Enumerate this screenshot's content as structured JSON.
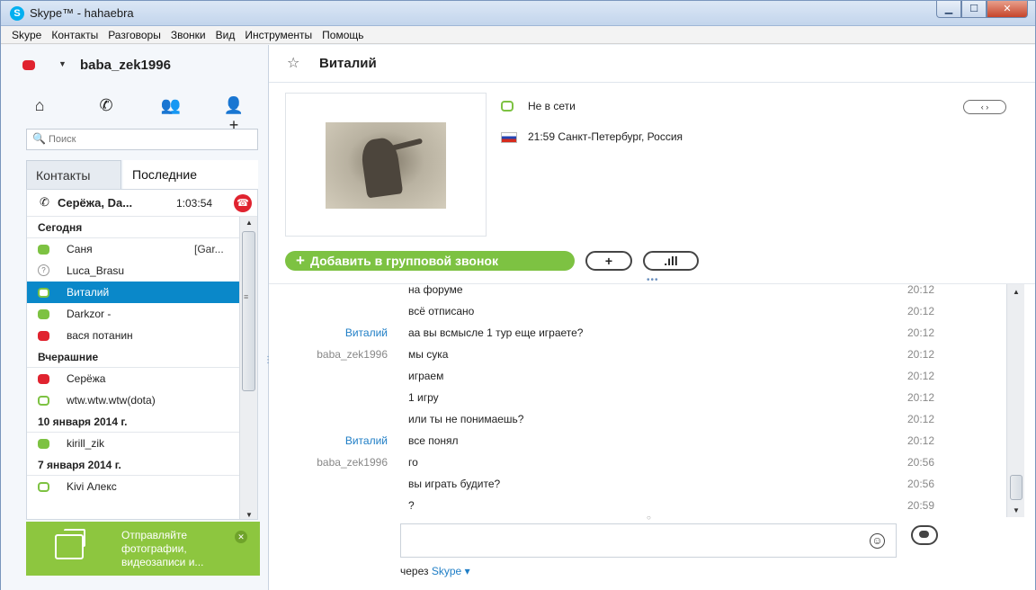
{
  "window": {
    "title": "Skype™ - hahaebra",
    "app_icon": "S"
  },
  "menu": [
    "Skype",
    "Контакты",
    "Разговоры",
    "Звонки",
    "Вид",
    "Инструменты",
    "Помощь"
  ],
  "me": {
    "name": "baba_zek1996",
    "status_color": "#e0232f"
  },
  "search": {
    "placeholder": "Поиск"
  },
  "tabs": {
    "contacts": "Контакты",
    "recent": "Последние"
  },
  "active_call": {
    "name": "Серёжа, Da...",
    "duration": "1:03:54"
  },
  "groups": [
    {
      "header": "Сегодня",
      "contacts": [
        {
          "name": "Саня",
          "status": "online",
          "extra": "[Gar..."
        },
        {
          "name": "Luca_Brasu",
          "status": "unknown",
          "extra": ""
        },
        {
          "name": "Виталий",
          "status": "offline",
          "extra": "",
          "selected": true
        },
        {
          "name": "Darkzor -",
          "status": "online",
          "extra": ""
        },
        {
          "name": "вася потанин",
          "status": "busy",
          "extra": ""
        }
      ]
    },
    {
      "header": "Вчерашние",
      "contacts": [
        {
          "name": "Серёжа",
          "status": "busy",
          "extra": ""
        },
        {
          "name": "wtw.wtw.wtw(dota)",
          "status": "offline",
          "extra": ""
        }
      ]
    },
    {
      "header": "10 января 2014 г.",
      "contacts": [
        {
          "name": "kirill_zik",
          "status": "online",
          "extra": ""
        }
      ]
    },
    {
      "header": "7 января 2014 г.",
      "contacts": [
        {
          "name": "Kivi Алекс",
          "status": "offline",
          "extra": ""
        }
      ]
    }
  ],
  "promo": {
    "text": "Отправляйте фотографии, видеозаписи и..."
  },
  "conversation": {
    "contact_name": "Виталий",
    "status_text": "Не в сети",
    "location": "21:59 Санкт-Петербург, Россия",
    "add_group_call": "Добавить в групповой звонок",
    "pager": "‹ ›"
  },
  "messages": [
    {
      "who": "",
      "side": "them",
      "text": "на форуме",
      "time": "20:12"
    },
    {
      "who": "",
      "side": "them",
      "text": "всё отписано",
      "time": "20:12"
    },
    {
      "who": "Виталий",
      "side": "them",
      "text": "аа вы всмысле 1 тур еще играете?",
      "time": "20:12"
    },
    {
      "who": "baba_zek1996",
      "side": "me",
      "text": "мы сука",
      "time": "20:12"
    },
    {
      "who": "",
      "side": "me",
      "text": "играем",
      "time": "20:12"
    },
    {
      "who": "",
      "side": "me",
      "text": "1 игру",
      "time": "20:12"
    },
    {
      "who": "",
      "side": "me",
      "text": "или ты не понимаешь?",
      "time": "20:12"
    },
    {
      "who": "Виталий",
      "side": "them",
      "text": "все понял",
      "time": "20:12"
    },
    {
      "who": "baba_zek1996",
      "side": "me",
      "text": "го",
      "time": "20:56"
    },
    {
      "who": "",
      "side": "me",
      "text": "вы играть будите?",
      "time": "20:56"
    },
    {
      "who": "",
      "side": "me",
      "text": "?",
      "time": "20:59"
    }
  ],
  "footer": {
    "via": "через",
    "via_link": "Skype"
  },
  "colors": {
    "accent": "#00aff0",
    "online": "#7dc242",
    "busy": "#e0232f",
    "selected": "#0a88c9"
  }
}
